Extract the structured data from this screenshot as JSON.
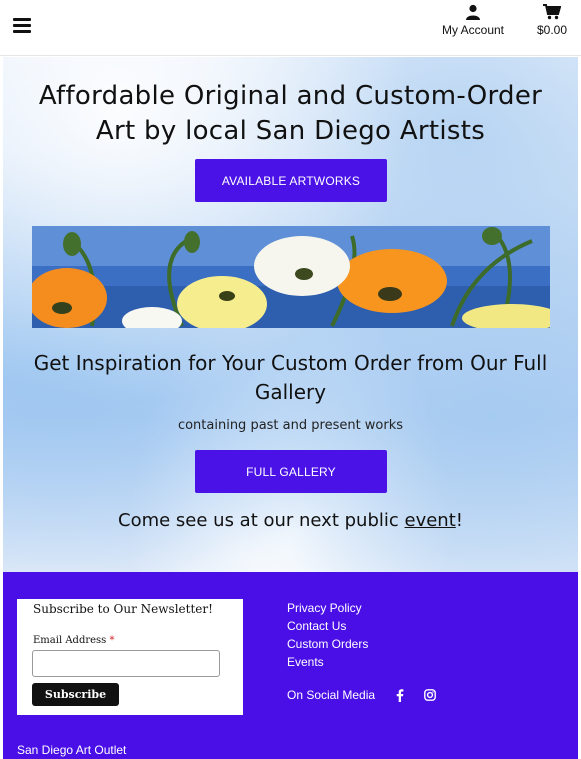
{
  "header": {
    "account_label": "My Account",
    "cart_total": "$0.00"
  },
  "hero": {
    "title": "Affordable Original and Custom-Order Art by local San Diego Artists",
    "primary_cta": "AVAILABLE ARTWORKS",
    "gallery_title": "Get Inspiration for Your Custom Order from Our Full Gallery",
    "gallery_note": "containing past and present works",
    "gallery_cta": "FULL GALLERY",
    "event_prefix": "Come see us at our next public ",
    "event_link": "event",
    "event_suffix": "!"
  },
  "newsletter": {
    "title": "Subscribe to Our Newsletter!",
    "email_label": "Email Address",
    "required_mark": "*",
    "email_value": "",
    "subscribe_label": "Subscribe"
  },
  "footer": {
    "links": [
      "Privacy Policy",
      "Contact Us",
      "Custom Orders",
      "Events"
    ],
    "social_label": "On Social Media",
    "social_icons": [
      "facebook-icon",
      "instagram-icon"
    ],
    "brand": "San Diego Art Outlet"
  },
  "colors": {
    "accent": "#4a12e6",
    "footer_bg": "#4a0fe6"
  }
}
